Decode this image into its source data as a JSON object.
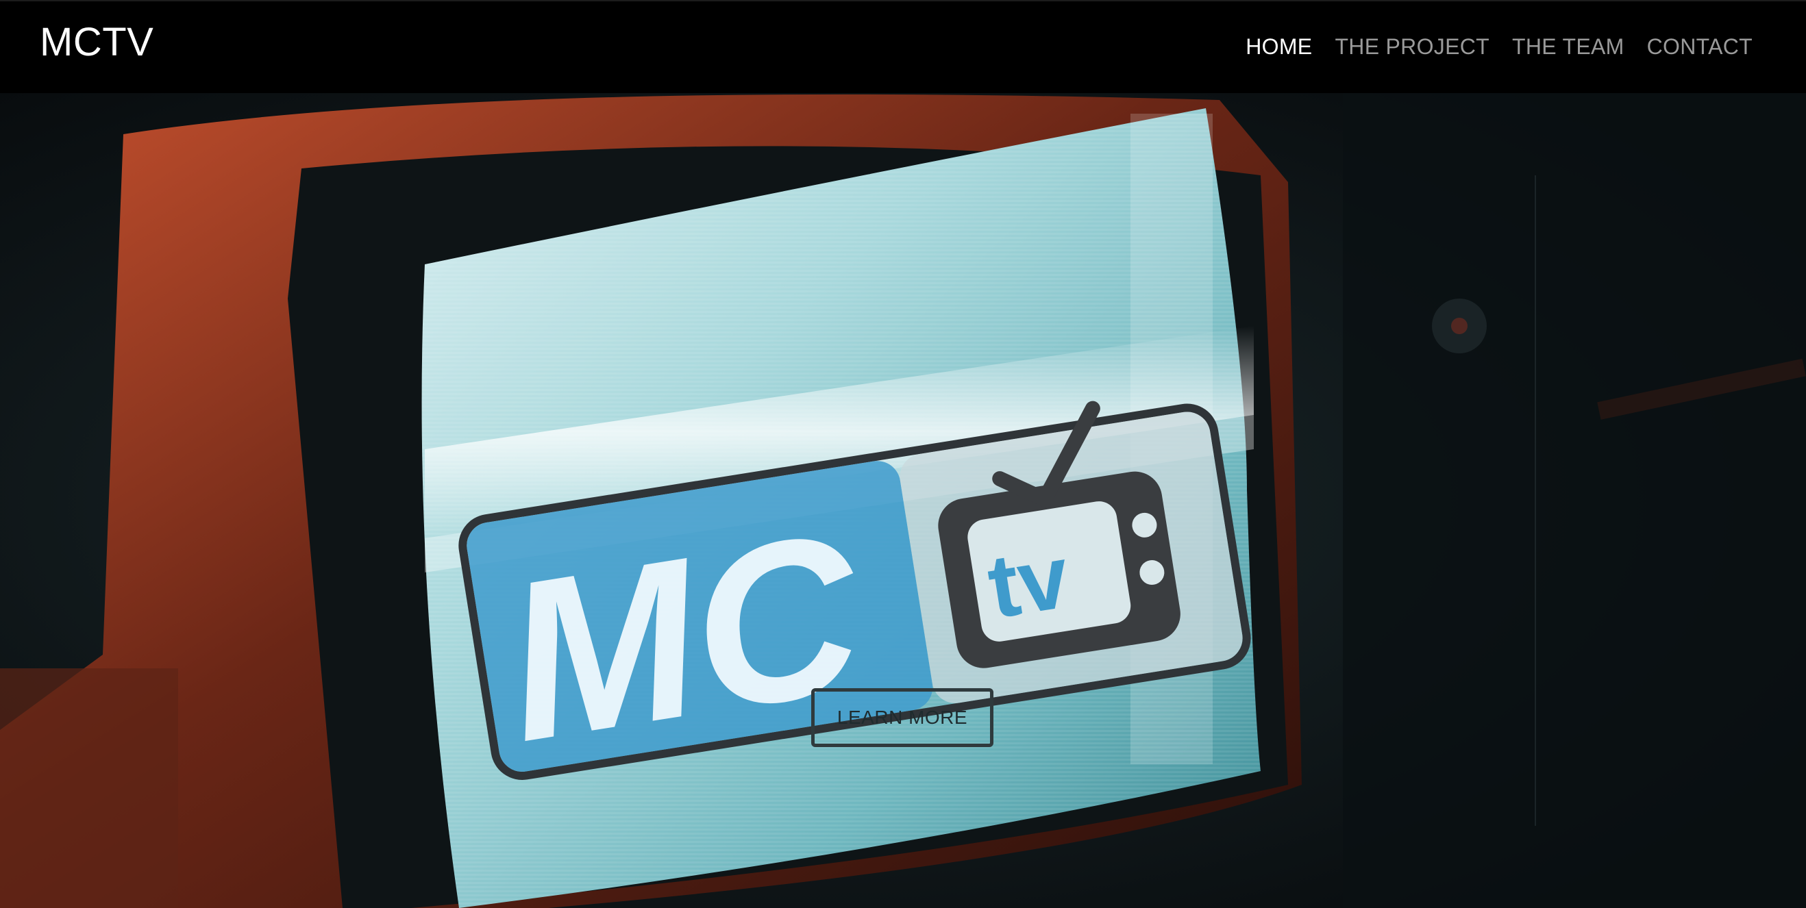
{
  "header": {
    "brand": "MCTV",
    "nav": [
      {
        "label": "HOME",
        "active": true
      },
      {
        "label": "THE PROJECT",
        "active": false
      },
      {
        "label": "THE TEAM",
        "active": false
      },
      {
        "label": "CONTACT",
        "active": false
      }
    ]
  },
  "hero": {
    "cta_label": "LEARN MORE",
    "logo": {
      "text_left": "MC",
      "text_right": "tv"
    }
  },
  "colors": {
    "nav_bg": "#000000",
    "nav_active": "#ffffff",
    "nav_inactive": "#9a9a9a",
    "screen_glow": "#9fd3d6",
    "logo_blue": "#3f9bcc",
    "tv_casing": "#b2452a"
  }
}
